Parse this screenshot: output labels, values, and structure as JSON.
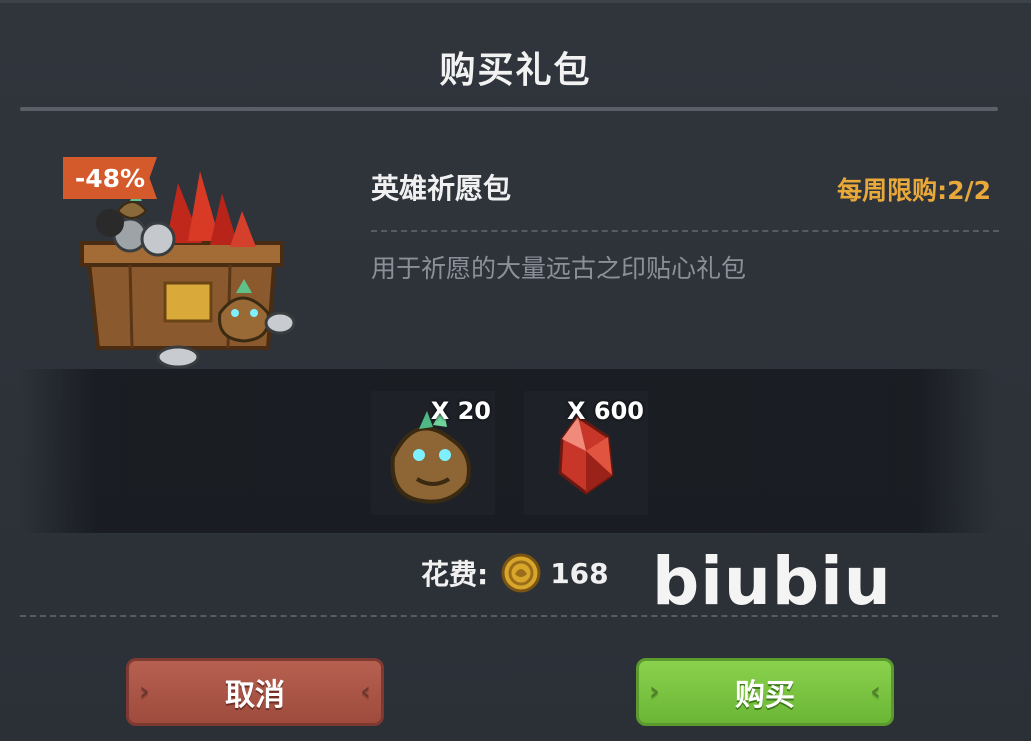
{
  "dialog": {
    "title": "购买礼包"
  },
  "pack": {
    "discount_badge": "-48%",
    "name": "英雄祈愿包",
    "weekly_limit": "每周限购:2/2",
    "description": "用于祈愿的大量远古之印贴心礼包",
    "icon": "treasure-chest-icon"
  },
  "items": [
    {
      "icon": "ancient-seal-icon",
      "quantity": "X 20"
    },
    {
      "icon": "red-crystal-icon",
      "quantity": "X 600"
    }
  ],
  "cost": {
    "label": "花费:",
    "icon": "gold-coin-icon",
    "amount": "168"
  },
  "watermark": "biubiu",
  "buttons": {
    "cancel": "取消",
    "buy": "购买"
  },
  "colors": {
    "discount": "#d45a2b",
    "weekly_limit": "#e9a83a",
    "cancel_button": "#a94f40",
    "buy_button": "#7bc443"
  }
}
